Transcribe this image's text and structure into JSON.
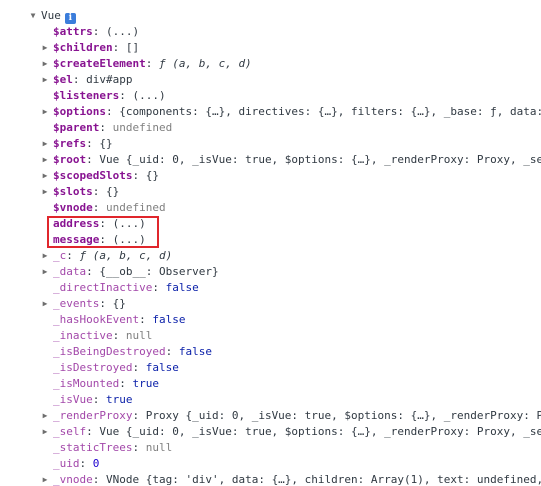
{
  "root": {
    "label": "Vue",
    "info_icon": "info-icon",
    "toggle_icon": "triangle-down-icon"
  },
  "highlight_color": "#e0262c",
  "colors": {
    "key": "#881391",
    "string": "#c41a16",
    "number": "#1c00cf",
    "boolean": "#0d22aa",
    "null": "#808080"
  },
  "rows": [
    {
      "key": "$attrs",
      "value": "(...)",
      "kind": "dots",
      "expandable": false,
      "style": "own"
    },
    {
      "key": "$children",
      "value": "[]",
      "kind": "obj",
      "expandable": true,
      "style": "own"
    },
    {
      "key": "$createElement",
      "value": "ƒ (a, b, c, d)",
      "kind": "func",
      "expandable": true,
      "style": "own"
    },
    {
      "key": "$el",
      "value": "div#app",
      "kind": "obj",
      "expandable": true,
      "style": "own"
    },
    {
      "key": "$listeners",
      "value": "(...)",
      "kind": "dots",
      "expandable": false,
      "style": "own"
    },
    {
      "key": "$options",
      "value": "{components: {…}, directives: {…}, filters: {…}, _base: ƒ, data:",
      "kind": "obj",
      "expandable": true,
      "style": "own"
    },
    {
      "key": "$parent",
      "value": "undefined",
      "kind": "null",
      "expandable": false,
      "style": "own"
    },
    {
      "key": "$refs",
      "value": "{}",
      "kind": "obj",
      "expandable": true,
      "style": "own"
    },
    {
      "key": "$root",
      "value": "Vue {_uid: 0, _isVue: true, $options: {…}, _renderProxy: Proxy, _se",
      "kind": "obj",
      "expandable": true,
      "style": "own"
    },
    {
      "key": "$scopedSlots",
      "value": "{}",
      "kind": "obj",
      "expandable": true,
      "style": "own"
    },
    {
      "key": "$slots",
      "value": "{}",
      "kind": "obj",
      "expandable": true,
      "style": "own"
    },
    {
      "key": "$vnode",
      "value": "undefined",
      "kind": "null",
      "expandable": false,
      "style": "own"
    },
    {
      "key": "address",
      "value": "(...)",
      "kind": "dots",
      "expandable": false,
      "style": "own"
    },
    {
      "key": "message",
      "value": "(...)",
      "kind": "dots",
      "expandable": false,
      "style": "own"
    },
    {
      "key": "_c",
      "value": "ƒ (a, b, c, d)",
      "kind": "func",
      "expandable": true,
      "style": "proto"
    },
    {
      "key": "_data",
      "value": "{__ob__: Observer}",
      "kind": "obj",
      "expandable": true,
      "style": "proto"
    },
    {
      "key": "_directInactive",
      "value": "false",
      "kind": "bool",
      "expandable": false,
      "style": "proto"
    },
    {
      "key": "_events",
      "value": "{}",
      "kind": "obj",
      "expandable": true,
      "style": "proto"
    },
    {
      "key": "_hasHookEvent",
      "value": "false",
      "kind": "bool",
      "expandable": false,
      "style": "proto"
    },
    {
      "key": "_inactive",
      "value": "null",
      "kind": "null",
      "expandable": false,
      "style": "proto"
    },
    {
      "key": "_isBeingDestroyed",
      "value": "false",
      "kind": "bool",
      "expandable": false,
      "style": "proto"
    },
    {
      "key": "_isDestroyed",
      "value": "false",
      "kind": "bool",
      "expandable": false,
      "style": "proto"
    },
    {
      "key": "_isMounted",
      "value": "true",
      "kind": "bool",
      "expandable": false,
      "style": "proto"
    },
    {
      "key": "_isVue",
      "value": "true",
      "kind": "bool",
      "expandable": false,
      "style": "proto"
    },
    {
      "key": "_renderProxy",
      "value": "Proxy {_uid: 0, _isVue: true, $options: {…}, _renderProxy: P",
      "kind": "obj",
      "expandable": true,
      "style": "proto"
    },
    {
      "key": "_self",
      "value": "Vue {_uid: 0, _isVue: true, $options: {…}, _renderProxy: Proxy, _se",
      "kind": "obj",
      "expandable": true,
      "style": "proto"
    },
    {
      "key": "_staticTrees",
      "value": "null",
      "kind": "null",
      "expandable": false,
      "style": "proto"
    },
    {
      "key": "_uid",
      "value": "0",
      "kind": "num",
      "expandable": false,
      "style": "proto"
    },
    {
      "key": "_vnode",
      "value": "VNode {tag: 'div', data: {…}, children: Array(1), text: undefined,",
      "kind": "obj",
      "expandable": true,
      "style": "proto"
    }
  ]
}
